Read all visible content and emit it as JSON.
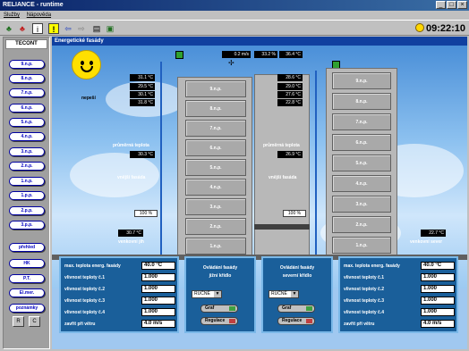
{
  "window": {
    "title": "RELIANCE - runtime"
  },
  "menu": [
    "Služby",
    "Nápověda"
  ],
  "toolbar": {
    "clock": "09:22:10"
  },
  "sidebar": {
    "logo": "TECONT",
    "floors": [
      "9.n.p.",
      "8.n.p.",
      "7.n.p.",
      "6.n.p.",
      "5.n.p.",
      "4.n.p.",
      "3.n.p.",
      "2.n.p.",
      "1.n.p.",
      "1.p.p.",
      "2.p.p.",
      "3.p.p."
    ],
    "views": [
      "přehled",
      "HK",
      "P.T.",
      "El.mer.",
      "poznámky"
    ],
    "bottom": [
      "R",
      "C"
    ]
  },
  "main": {
    "title": "Energetické fasády",
    "weather_label": "nepeší",
    "top_readouts": [
      "0.2 m/s",
      "33.2 %",
      "36.4 °C"
    ],
    "left_temps": [
      "31.1 °C",
      "29.5 °C",
      "30.1 °C",
      "31.8 °C"
    ],
    "right_temps": [
      "28.6 °C",
      "29.0 °C",
      "27.6 °C",
      "22.8 °C"
    ],
    "left_mid_label": "průměrná teplota",
    "left_mid_value": "30.3 °C",
    "right_mid_label": "průměrná teplota",
    "right_mid_value": "26.9 °C",
    "left_intake_label": "vnější fasáda",
    "right_intake_label": "vnější fasáda",
    "left_pct": "100 %",
    "right_pct": "100 %",
    "left_outside": "30.7 °C",
    "right_outside": "22.7 °C",
    "left_outside_label": "venkovní jih",
    "right_outside_label": "venkovní sever",
    "left_floors": [
      "9.n.p.",
      "8.n.p.",
      "7.n.p.",
      "6.n.p.",
      "5.n.p.",
      "4.n.p.",
      "3.n.p.",
      "2.n.p.",
      "1.n.p."
    ],
    "right_floors": [
      "9.n.p.",
      "8.n.p.",
      "7.n.p.",
      "6.n.p.",
      "5.n.p.",
      "4.n.p.",
      "3.n.p.",
      "2.n.p.",
      "1.n.p."
    ]
  },
  "panels": {
    "left": {
      "rows": [
        {
          "label": "max. teplota energ. fasády",
          "value": "40.0 °C"
        },
        {
          "label": "vlivnost teploty č.1",
          "value": "1.000"
        },
        {
          "label": "vlivnost teploty č.2",
          "value": "1.000"
        },
        {
          "label": "vlivnost teploty č.3",
          "value": "1.000"
        },
        {
          "label": "vlivnost teploty č.4",
          "value": "1.000"
        },
        {
          "label": "zavřít při větru",
          "value": "4.0 m/s"
        }
      ]
    },
    "mid_left": {
      "title": "Ovládání fasády",
      "subtitle": "jižní křídlo",
      "mode": "RUČNĚ",
      "graph": "Graf",
      "reg": "Regulace"
    },
    "mid_right": {
      "title": "Ovládání fasády",
      "subtitle": "severní křídlo",
      "mode": "RUČNĚ",
      "graph": "Graf",
      "reg": "Regulace"
    },
    "right": {
      "rows": [
        {
          "label": "max. teplota energ. fasády",
          "value": "40.0 °C"
        },
        {
          "label": "vlivnost teploty č.1",
          "value": "1.000"
        },
        {
          "label": "vlivnost teploty č.2",
          "value": "1.000"
        },
        {
          "label": "vlivnost teploty č.3",
          "value": "1.000"
        },
        {
          "label": "vlivnost teploty č.4",
          "value": "1.000"
        },
        {
          "label": "zavřít při větru",
          "value": "4.0 m/s"
        }
      ]
    }
  }
}
